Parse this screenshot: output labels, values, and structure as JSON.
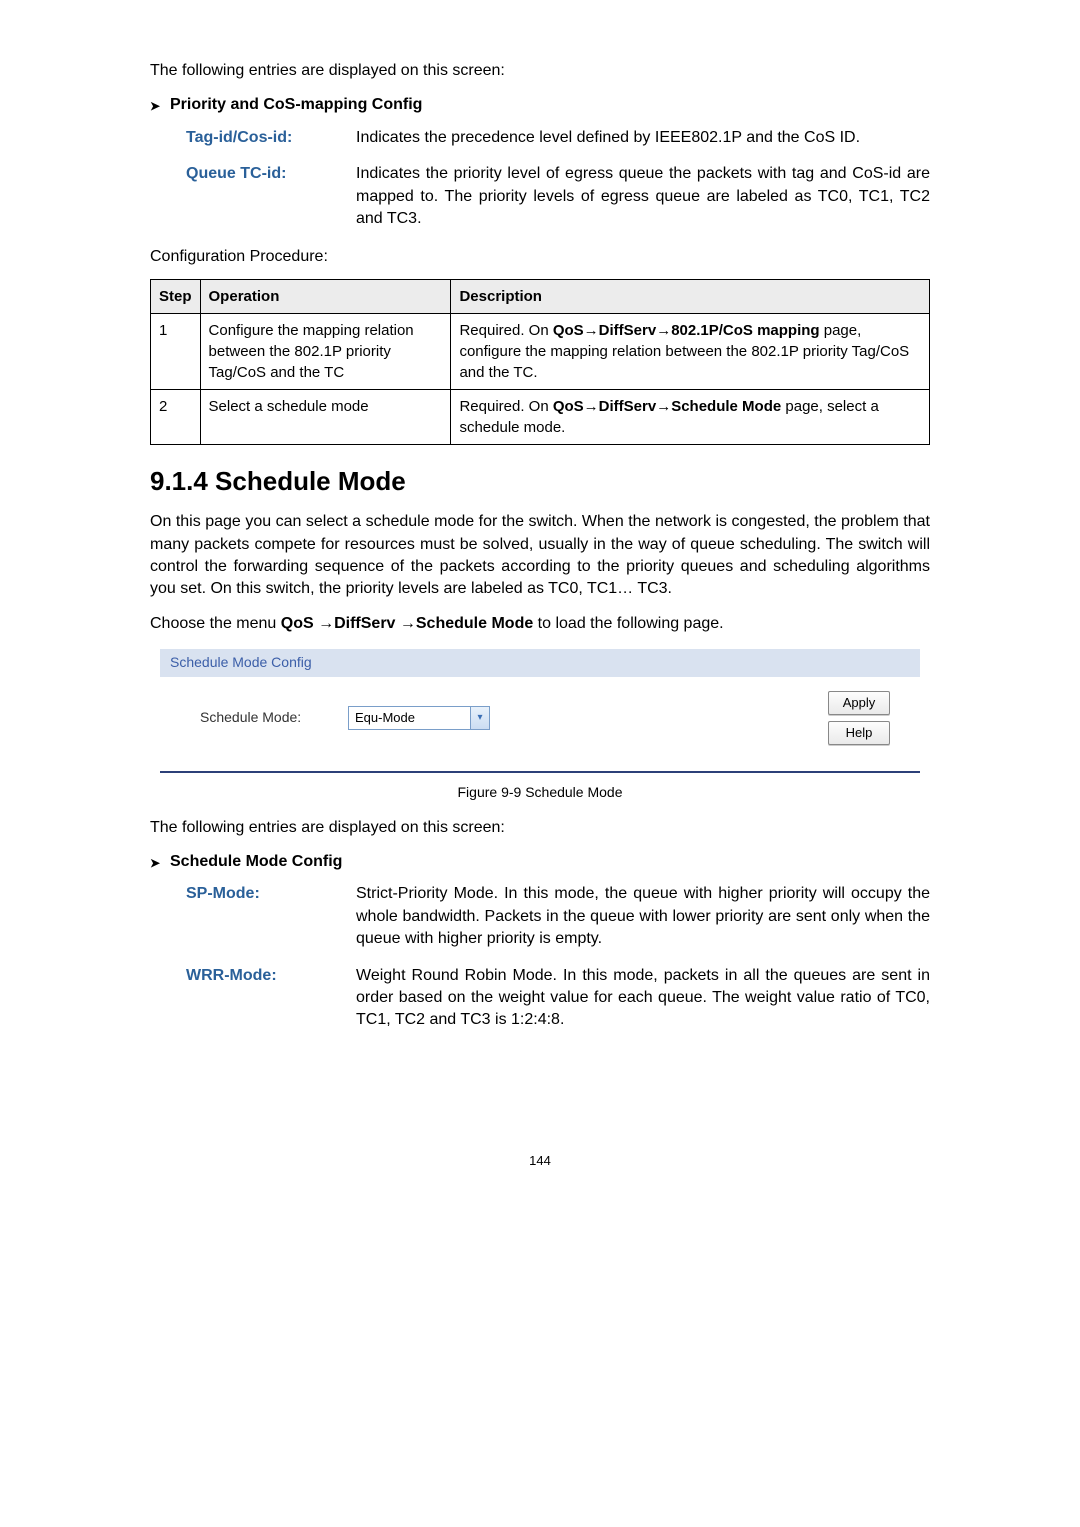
{
  "intro1": "The following entries are displayed on this screen:",
  "section1": {
    "title": "Priority and CoS-mapping Config",
    "defs": [
      {
        "label": "Tag-id/Cos-id:",
        "text": "Indicates the precedence level defined by IEEE802.1P and the CoS ID."
      },
      {
        "label": "Queue TC-id:",
        "text": "Indicates the priority level of egress queue the packets with tag and CoS-id are mapped to. The priority levels of egress queue are labeled as TC0, TC1, TC2 and TC3."
      }
    ]
  },
  "config_proc_heading": "Configuration Procedure:",
  "table": {
    "headers": [
      "Step",
      "Operation",
      "Description"
    ],
    "rows": [
      {
        "step": "1",
        "op": "Configure the mapping relation between the 802.1P priority Tag/CoS and the TC",
        "desc_pre": "Required. On ",
        "desc_bold": "QoS→DiffServ→802.1P/CoS mapping",
        "desc_post": " page, configure the mapping relation between the 802.1P priority Tag/CoS and the TC."
      },
      {
        "step": "2",
        "op": "Select a schedule mode",
        "desc_pre": "Required. On ",
        "desc_bold": "QoS→DiffServ→Schedule Mode",
        "desc_post": " page, select a schedule mode."
      }
    ]
  },
  "h3": "9.1.4 Schedule Mode",
  "para1": "On this page you can select a schedule mode for the switch. When the network is congested, the problem that many packets compete for resources must be solved, usually in the way of queue scheduling. The switch will control the forwarding sequence of the packets according to the priority queues and scheduling algorithms you set. On this switch, the priority levels are labeled as TC0, TC1… TC3.",
  "menu_line_pre": "Choose the menu ",
  "menu_line_bold": "QoS →DiffServ →Schedule Mode",
  "menu_line_post": " to load the following page.",
  "ui": {
    "panel_title": "Schedule Mode Config",
    "label": "Schedule Mode:",
    "select_value": "Equ-Mode",
    "apply": "Apply",
    "help": "Help"
  },
  "fig_caption": "Figure 9-9 Schedule Mode",
  "intro2": "The following entries are displayed on this screen:",
  "section2": {
    "title": "Schedule Mode Config",
    "defs": [
      {
        "label": "SP-Mode:",
        "text": "Strict-Priority Mode. In this mode, the queue with higher priority will occupy the whole bandwidth. Packets in the queue with lower priority are sent only when the queue with higher priority is empty."
      },
      {
        "label": "WRR-Mode:",
        "text": "Weight Round Robin Mode. In this mode, packets in all the queues are sent in order based on the weight value for each queue. The weight value ratio of TC0, TC1, TC2 and TC3 is 1:2:4:8."
      }
    ]
  },
  "page_num": "144"
}
